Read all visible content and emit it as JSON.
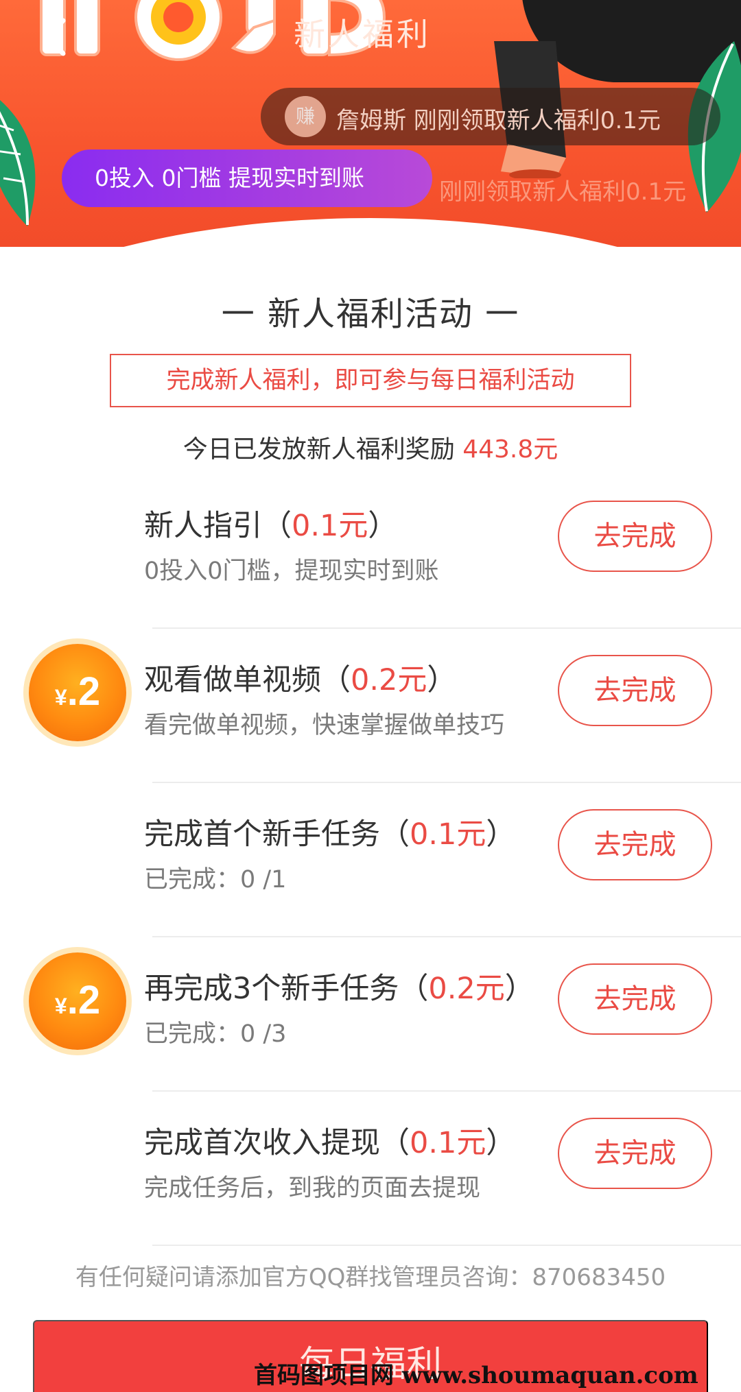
{
  "header": {
    "title": "新人福利",
    "ticker": {
      "avatar_text": "赚",
      "text": "詹姆斯    刚刚领取新人福利0.1元",
      "ghost_text": "刚刚领取新人福利0.1元"
    },
    "promo": "0投入  0门槛  提现实时到账"
  },
  "section": {
    "title": "一  新人福利活动  一",
    "notice": "完成新人福利，即可参与每日福利活动",
    "issued_label": "今日已发放新人福利奖励 ",
    "issued_amount": "443.8元"
  },
  "tasks": [
    {
      "title": "新人指引（",
      "reward": "0.1元",
      "close": "）",
      "subtitle": "0投入0门槛，提现实时到账",
      "button": "去完成"
    },
    {
      "title": "观看做单视频（",
      "reward": "0.2元",
      "close": "）",
      "subtitle": "看完做单视频，快速掌握做单技巧",
      "button": "去完成",
      "coin": {
        "yen": "¥",
        "value": ".2"
      }
    },
    {
      "title": "完成首个新手任务（",
      "reward": "0.1元",
      "close": "）",
      "subtitle": "已完成：0 /1",
      "button": "去完成"
    },
    {
      "title": "再完成3个新手任务（",
      "reward": "0.2元",
      "close": "）",
      "subtitle": "已完成：0 /3",
      "button": "去完成",
      "coin": {
        "yen": "¥",
        "value": ".2"
      }
    },
    {
      "title": "完成首次收入提现（",
      "reward": "0.1元",
      "close": "）",
      "subtitle": "完成任务后，到我的页面去提现",
      "button": "去完成"
    }
  ],
  "footer": {
    "help": "有任何疑问请添加官方QQ群找管理员咨询：870683450",
    "daily_button": "每日福利",
    "watermark": "首码图项目网 www.shoumaquan.com"
  },
  "colors": {
    "accent": "#ea4b44",
    "banner": "#f8552e",
    "promo": "#9a35e6",
    "coin": "#ff8a10"
  }
}
